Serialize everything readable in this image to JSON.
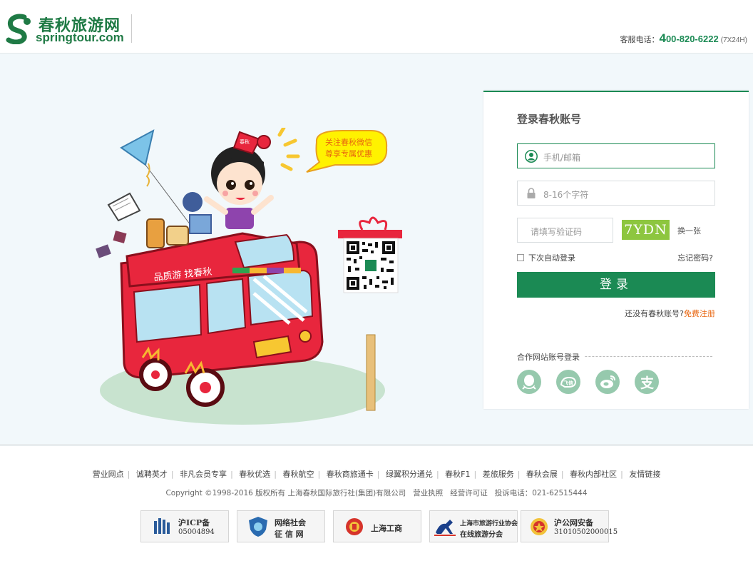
{
  "header": {
    "logo_cn": "春秋旅游网",
    "logo_en": "springtour.com",
    "hotline_label": "客服电话：",
    "hotline_first": "4",
    "hotline_rest": "00-820-6222",
    "hotline_hours": "(7X24H)"
  },
  "promo": {
    "bubble_line1": "关注春秋微信",
    "bubble_line2": "尊享专属优惠",
    "bus_slogan": "品质游 找春秋",
    "hat_text": "春秋"
  },
  "login": {
    "title": "登录春秋账号",
    "user_placeholder": "手机/邮箱",
    "password_placeholder": "8-16个字符",
    "captcha_placeholder": "请填写验证码",
    "captcha_text": "7YDN",
    "captcha_refresh": "换一张",
    "remember_label": "下次自动登录",
    "forgot_label": "忘记密码?",
    "submit_label": "登录",
    "register_prompt": "还没有春秋账号?",
    "register_link": "免费注册",
    "partner_label": "合作网站账号登录",
    "partners": [
      "qq-icon",
      "feixin-icon",
      "weibo-icon",
      "alipay-icon"
    ]
  },
  "footer": {
    "links": [
      "营业网点",
      "诚聘英才",
      "非凡会员专享",
      "春秋优选",
      "春秋航空",
      "春秋商旅通卡",
      "绿翼积分通兑",
      "春秋F1",
      "差旅服务",
      "春秋会展",
      "春秋内部社区",
      "友情链接"
    ],
    "copyright": "Copyright ©1998-2016 版权所有 上海春秋国际旅行社(集团)有限公司",
    "license": "营业执照",
    "permit": "经营许可证",
    "complaint": "投诉电话：021-62515444",
    "badges": {
      "icp_title": "沪ICP备",
      "icp_num": "05004894",
      "credit_line1": "网络社会",
      "credit_line2": "征 信 网",
      "aic": "上海工商",
      "assoc_line1": "上海市旅游行业协会",
      "assoc_line2": "在线旅游分会",
      "police_title": "沪公网安备",
      "police_num": "31010502000015"
    }
  },
  "colors": {
    "brand_green": "#1b8a54",
    "register_orange": "#e8650f",
    "captcha_green": "#8dc63f",
    "main_bg": "#f2f8fb"
  }
}
